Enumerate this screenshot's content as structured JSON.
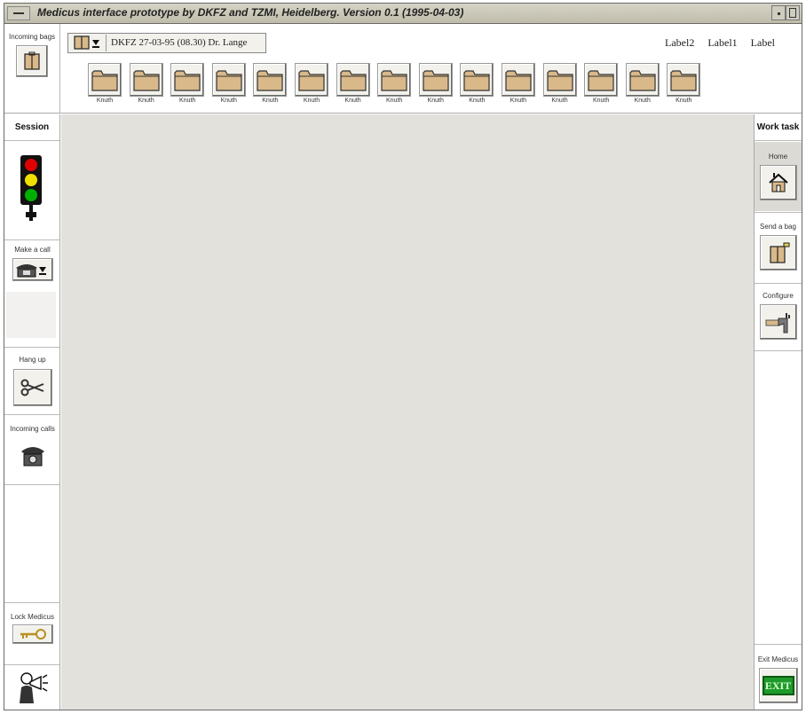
{
  "window": {
    "title": "Medicus interface prototype by DKFZ and TZMI, Heidelberg. Version 0.1 (1995-04-03)"
  },
  "topbar": {
    "incoming_bags_label": "Incoming bags",
    "selector_text": "DKFZ 27-03-95 (08.30) Dr. Lange",
    "labels": [
      "Label2",
      "Label1",
      "Label"
    ],
    "folders": [
      "Knuth",
      "Knuth",
      "Knuth",
      "Knuth",
      "Knuth",
      "Knuth",
      "Knuth",
      "Knuth",
      "Knuth",
      "Knuth",
      "Knuth",
      "Knuth",
      "Knuth",
      "Knuth",
      "Knuth"
    ]
  },
  "left": {
    "header": "Session",
    "make_call": "Make a call",
    "hang_up": "Hang up",
    "incoming_calls": "Incoming calls",
    "lock": "Lock Medicus"
  },
  "right": {
    "header": "Work task",
    "home": "Home",
    "send_bag": "Send a bag",
    "configure": "Configure",
    "exit": "Exit Medicus",
    "exit_sign": "EXIT"
  },
  "colors": {
    "folder": "#d9b98a",
    "workspace": "#e3e1dc",
    "exit": "#1e9a2a"
  }
}
